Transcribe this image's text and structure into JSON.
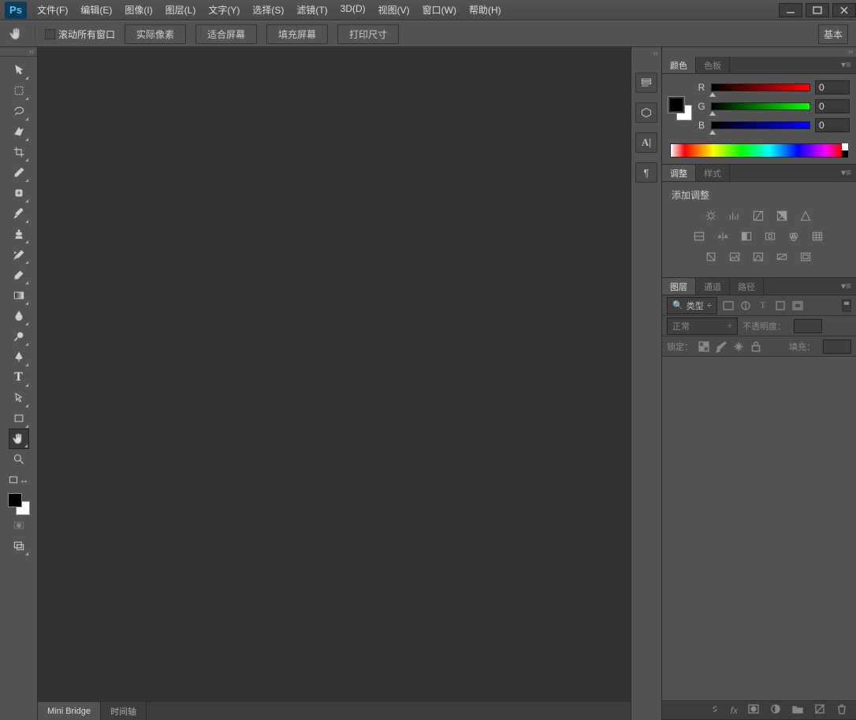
{
  "app": {
    "logo": "Ps"
  },
  "menu": [
    "文件(F)",
    "编辑(E)",
    "图像(I)",
    "图层(L)",
    "文字(Y)",
    "选择(S)",
    "滤镜(T)",
    "3D(D)",
    "视图(V)",
    "窗口(W)",
    "帮助(H)"
  ],
  "options": {
    "scroll_all_label": "滚动所有窗口",
    "buttons": [
      "实际像素",
      "适合屏幕",
      "填充屏幕",
      "打印尺寸"
    ],
    "basic": "基本"
  },
  "bottom_tabs": [
    "Mini Bridge",
    "时间轴"
  ],
  "color_panel": {
    "tabs": [
      "颜色",
      "色板"
    ],
    "r_label": "R",
    "g_label": "G",
    "b_label": "B",
    "r": "0",
    "g": "0",
    "b": "0"
  },
  "adjust_panel": {
    "tabs": [
      "调整",
      "样式"
    ],
    "title": "添加调整"
  },
  "layers_panel": {
    "tabs": [
      "图层",
      "通道",
      "路径"
    ],
    "filter_kind": "类型",
    "blend_mode": "正常",
    "opacity_label": "不透明度：",
    "lock_label": "锁定：",
    "fill_label": "填充："
  }
}
